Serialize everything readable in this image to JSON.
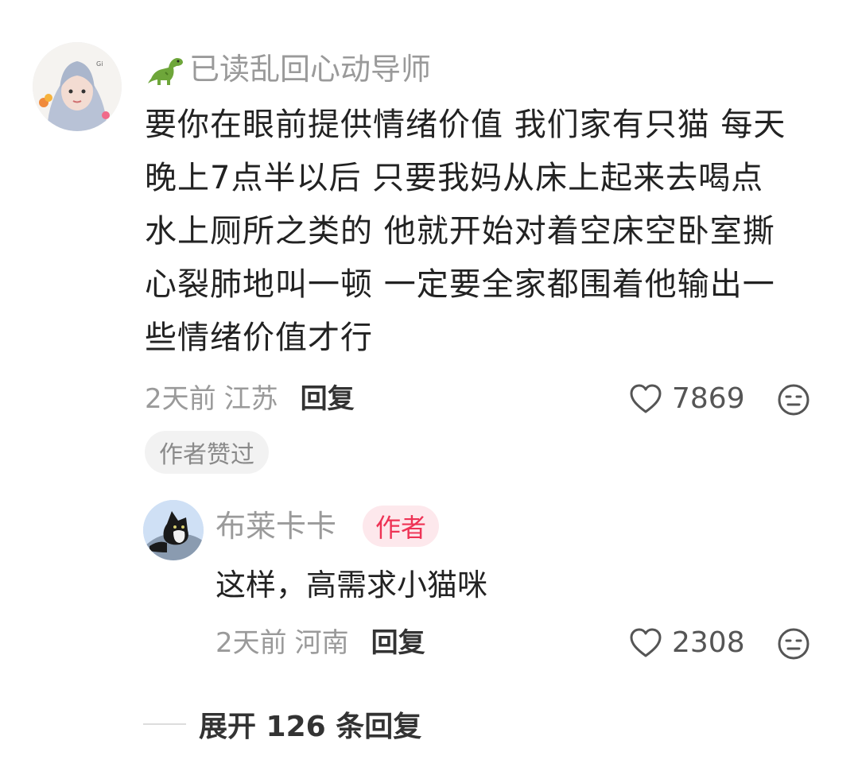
{
  "comment": {
    "username": "已读乱回心动导师",
    "username_icon": "dinosaur-icon",
    "text_lines": [
      "要你在眼前提供情绪价值 我们家有只猫 每天",
      "晚上7点半以后 只要我妈从床上起来去喝点",
      "水上厕所之类的 他就开始对着空床空卧室撕",
      "心裂肺地叫一顿 一定要全家都围着他输出一",
      "些情绪价值才行"
    ],
    "time": "2天前",
    "location": "江苏",
    "reply_label": "回复",
    "likes": "7869",
    "author_liked_tag": "作者赞过"
  },
  "reply": {
    "username": "布莱卡卡",
    "badge": "作者",
    "text": "这样，高需求小猫咪",
    "time": "2天前",
    "location": "河南",
    "reply_label": "回复",
    "likes": "2308"
  },
  "expand": {
    "label": "展开 126 条回复"
  },
  "colors": {
    "badge_text": "#ee3355",
    "badge_bg": "#fde8ec",
    "secondary_text": "#9a9a9a",
    "primary_text": "#222222"
  }
}
